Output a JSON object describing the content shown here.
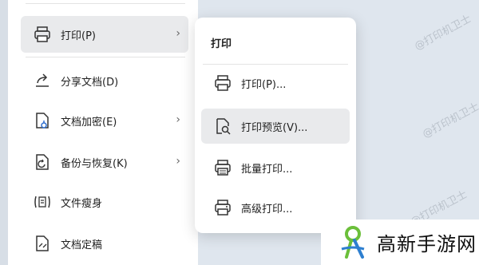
{
  "main_menu": {
    "items": [
      {
        "label": "打印(P)",
        "icon": "printer-icon",
        "has_submenu": true,
        "active": true
      },
      {
        "label": "分享文档(D)",
        "icon": "share-icon",
        "has_submenu": false
      },
      {
        "label": "文档加密(E)",
        "icon": "encrypt-document-icon",
        "has_submenu": true
      },
      {
        "label": "备份与恢复(K)",
        "icon": "backup-restore-icon",
        "has_submenu": true
      },
      {
        "label": "文件瘦身",
        "icon": "compress-file-icon",
        "has_submenu": false
      },
      {
        "label": "文档定稿",
        "icon": "finalize-document-icon",
        "has_submenu": false
      }
    ]
  },
  "print_submenu": {
    "title": "打印",
    "items": [
      {
        "label": "打印(P)...",
        "icon": "printer-icon"
      },
      {
        "label": "打印预览(V)...",
        "icon": "print-preview-icon",
        "active": true
      },
      {
        "label": "批量打印...",
        "icon": "batch-print-icon"
      },
      {
        "label": "高级打印...",
        "icon": "advanced-print-icon"
      }
    ]
  },
  "watermark": "@打印机卫士",
  "brand": {
    "name": "高新手游网",
    "colors": {
      "green": "#6bbf3a",
      "blue": "#2e7fd0"
    }
  }
}
